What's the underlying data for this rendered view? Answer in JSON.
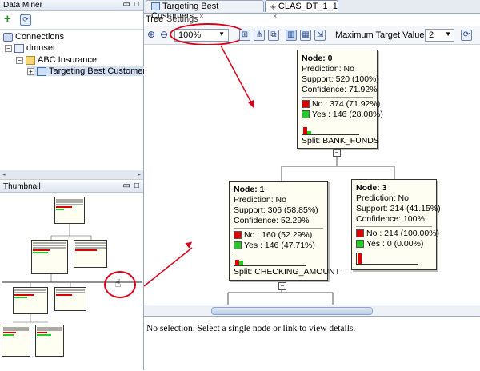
{
  "left": {
    "data_miner_title": "Data Miner",
    "connections_label": "Connections",
    "user_label": "dmuser",
    "project_label": "ABC Insurance",
    "workflow_label": "Targeting Best Customers",
    "thumbnail_title": "Thumbnail"
  },
  "tabs": [
    {
      "label": "Targeting Best Customers"
    },
    {
      "label": "CLAS_DT_1_1"
    }
  ],
  "subtabs": {
    "tree": "Tree",
    "settings": "Settings"
  },
  "toolbar": {
    "zoom_value": "100%",
    "max_target_label": "Maximum Target Values:",
    "max_target_value": "2"
  },
  "status": "No selection. Select a single node or link to view details.",
  "colors": {
    "no": "#dd0000",
    "yes": "#22cc22",
    "accent": "#d9001b"
  },
  "nodes": [
    {
      "title": "Node: 0",
      "prediction": "Prediction: No",
      "support": "Support: 520 (100%)",
      "confidence": "Confidence: 71.92%",
      "no": "No : 374  (71.92%)",
      "yes": "Yes : 146  (28.08%)",
      "no_frac": 0.7192,
      "yes_frac": 0.2808,
      "split": "Split: BANK_FUNDS"
    },
    {
      "title": "Node: 1",
      "prediction": "Prediction: No",
      "support": "Support: 306 (58.85%)",
      "confidence": "Confidence: 52.29%",
      "no": "No : 160  (52.29%)",
      "yes": "Yes : 146  (47.71%)",
      "no_frac": 0.5229,
      "yes_frac": 0.4771,
      "split": "Split: CHECKING_AMOUNT"
    },
    {
      "title": "Node: 3",
      "prediction": "Prediction: No",
      "support": "Support: 214 (41.15%)",
      "confidence": "Confidence: 100%",
      "no": "No : 214  (100.00%)",
      "yes": "Yes : 0  (0.00%)",
      "no_frac": 1.0,
      "yes_frac": 0.0,
      "split": ""
    }
  ]
}
